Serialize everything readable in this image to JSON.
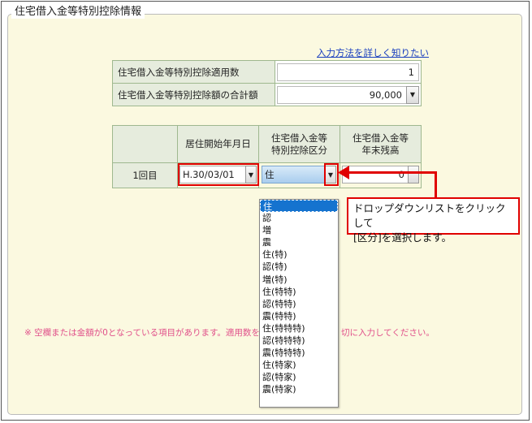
{
  "section": {
    "legend": "住宅借入金等特別控除情報",
    "help_link": "入力方法を詳しく知りたい"
  },
  "summary": {
    "rows": [
      {
        "label": "住宅借入金等特別控除適用数",
        "value": "1"
      },
      {
        "label": "住宅借入金等特別控除額の合計額",
        "value": "90,000"
      }
    ]
  },
  "detail": {
    "headers": [
      "居住開始年月日",
      "住宅借入金等\n特別控除区分",
      "住宅借入金等\n年末残高"
    ],
    "row_label": "1回目",
    "move_in_date": "H.30/03/01",
    "category": "住",
    "year_end_balance": "0"
  },
  "notes": {
    "left": "※ 空欄または金額が0となっている項目があります。適用数を",
    "right": "切に入力してください。"
  },
  "dropdown": {
    "options": [
      "住",
      "認",
      "増",
      "震",
      "住(特)",
      "認(特)",
      "増(特)",
      "住(特特)",
      "認(特特)",
      "震(特特)",
      "住(特特特)",
      "認(特特特)",
      "震(特特特)",
      "住(特家)",
      "認(特家)",
      "震(特家)"
    ],
    "selected_index": 0
  },
  "callout": {
    "line1": "ドロップダウンリストをクリックして",
    "line2": "[区分]を選択します。"
  },
  "colors": {
    "annotation_red": "#e00000",
    "panel_bg": "#fbf9e0",
    "cell_header_bg": "#e6ecdd",
    "link_blue": "#1a3fbf",
    "note_pink": "#e0508a",
    "selected_option_bg": "#1573cf"
  }
}
